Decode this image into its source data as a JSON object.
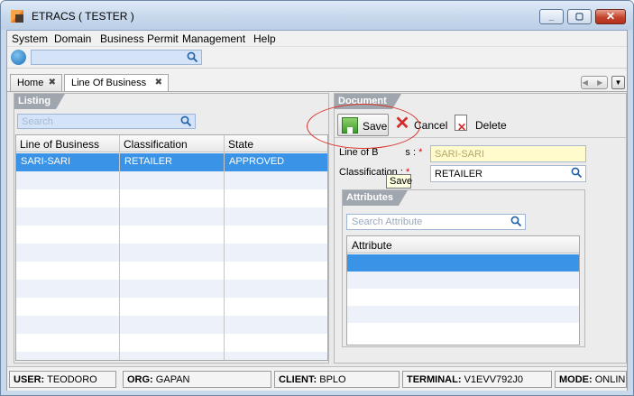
{
  "window": {
    "title": "ETRACS ( TESTER )",
    "minimize_glyph": "_",
    "maximize_glyph": "▢",
    "close_glyph": "✕"
  },
  "menu": [
    "System",
    "Domain",
    "Business Permit",
    "Management",
    "Help"
  ],
  "tabs": [
    {
      "label": "Home",
      "close": "✖"
    },
    {
      "label": "Line Of Business",
      "close": "✖"
    }
  ],
  "nav": {
    "arrows": "◀ ▶",
    "menu": "▼"
  },
  "listing": {
    "title": "Listing",
    "search_placeholder": "Search",
    "columns": [
      "Line of Business",
      "Classification",
      "State"
    ],
    "rows": [
      [
        "SARI-SARI",
        "RETAILER",
        "APPROVED"
      ]
    ]
  },
  "document": {
    "title": "Document",
    "toolbar": {
      "save": "Save",
      "cancel": "Cancel",
      "delete": "Delete"
    },
    "tooltip": "Save",
    "fields": {
      "line_of_business_label": "Line of B",
      "line_of_business_label_tail": "s :",
      "line_of_business_value": "SARI-SARI",
      "classification_label": "Classification :",
      "classification_value": "RETAILER",
      "required_mark": "*"
    },
    "attributes": {
      "title": "Attributes",
      "search_placeholder": "Search Attribute",
      "column": "Attribute"
    }
  },
  "status": {
    "user_label": "USER:",
    "user": "TEODORO",
    "org_label": "ORG:",
    "org": "GAPAN",
    "client_label": "CLIENT:",
    "client": "BPLO",
    "terminal_label": "TERMINAL:",
    "terminal": "V1EVV792J0",
    "mode_label": "MODE:",
    "mode": "ONLINE"
  },
  "colors": {
    "accent": "#3a93e6",
    "annotation": "#d9342b"
  }
}
